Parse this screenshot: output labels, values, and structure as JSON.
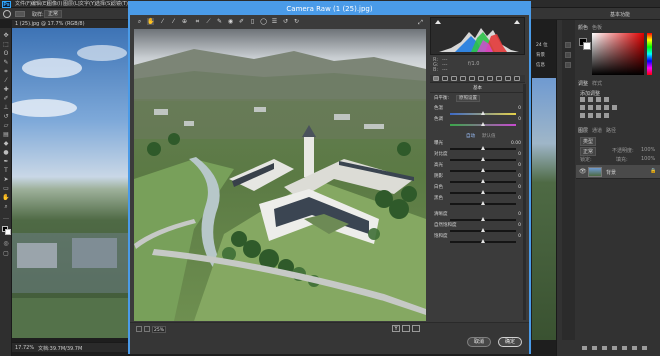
{
  "app": {
    "logo": "Ps",
    "menus": [
      "文件(F)",
      "编辑(E)",
      "图像(I)",
      "图层(L)",
      "文字(Y)",
      "选择(S)",
      "滤镜(T)",
      "3D(D)",
      "视图(V)",
      "窗口(W)",
      "帮助(H)"
    ],
    "options_bar": {
      "sample_label": "取样:",
      "sample_value": "正常",
      "workspace": "基本功能"
    },
    "doc_tab": "1 (25).jpg @ 17.7% (RGB/8)",
    "status": {
      "zoom": "17.72%",
      "doc_info": "文档:39.7M/39.7M"
    }
  },
  "ps_panels": {
    "color_tabs": [
      "颜色",
      "色板"
    ],
    "adjust_tabs": [
      "调整",
      "样式"
    ],
    "adjust_title": "添加调整",
    "layers_tabs": [
      "图层",
      "通道",
      "路径"
    ],
    "layer_filter": "类型",
    "blend_mode": "正常",
    "opacity_label": "不透明度:",
    "opacity": "100%",
    "lock_label": "锁定:",
    "fill_label": "填充:",
    "fill": "100%",
    "layer_name": "背景",
    "left_panel_labels": [
      "24 位",
      "背景",
      "信息"
    ]
  },
  "camera_raw": {
    "title": "Camera Raw (1 (25).jpg)",
    "tool_icons": [
      "zoom-icon",
      "hand-icon",
      "white-balance-icon",
      "color-sampler-icon",
      "targeted-adjustment-icon",
      "crop-icon",
      "straighten-icon",
      "spot-removal-icon",
      "red-eye-icon",
      "adjustment-brush-icon",
      "graduated-filter-icon",
      "radial-filter-icon",
      "rotate-left-icon",
      "rotate-right-icon"
    ],
    "histogram_readout": {
      "r": "R:",
      "g": "G:",
      "b": "B:",
      "dash": "---",
      "exposure": "f/1.0"
    },
    "panel_title": "基本",
    "white_balance_label": "白平衡:",
    "white_balance_value": "原照设置",
    "sliders_wb": [
      {
        "label": "色温",
        "value": "0",
        "pos": 0.5,
        "gradient": "linear-gradient(to right,#3c69c8,#e6d24a)"
      },
      {
        "label": "色调",
        "value": "0",
        "pos": 0.5,
        "gradient": "linear-gradient(to right,#3aa64a,#c84ad0)"
      }
    ],
    "auto_label": "自动",
    "default_label": "默认值",
    "sliders_tone": [
      {
        "label": "曝光",
        "value": "0.00",
        "pos": 0.5
      },
      {
        "label": "对比度",
        "value": "0",
        "pos": 0.5
      },
      {
        "label": "高光",
        "value": "0",
        "pos": 0.5
      },
      {
        "label": "阴影",
        "value": "0",
        "pos": 0.5
      },
      {
        "label": "白色",
        "value": "0",
        "pos": 0.5
      },
      {
        "label": "黑色",
        "value": "0",
        "pos": 0.5
      }
    ],
    "sliders_presence": [
      {
        "label": "清晰度",
        "value": "0",
        "pos": 0.5
      },
      {
        "label": "自然饱和度",
        "value": "0",
        "pos": 0.5
      },
      {
        "label": "饱和度",
        "value": "0",
        "pos": 0.5
      }
    ],
    "zoom_value": "25%",
    "cancel_button": "取消",
    "ok_button": "确定"
  },
  "colors": {
    "dialog_border": "#4a9be8",
    "panel_bg": "#3b3b3b",
    "ps_bg": "#1e1e1e"
  }
}
